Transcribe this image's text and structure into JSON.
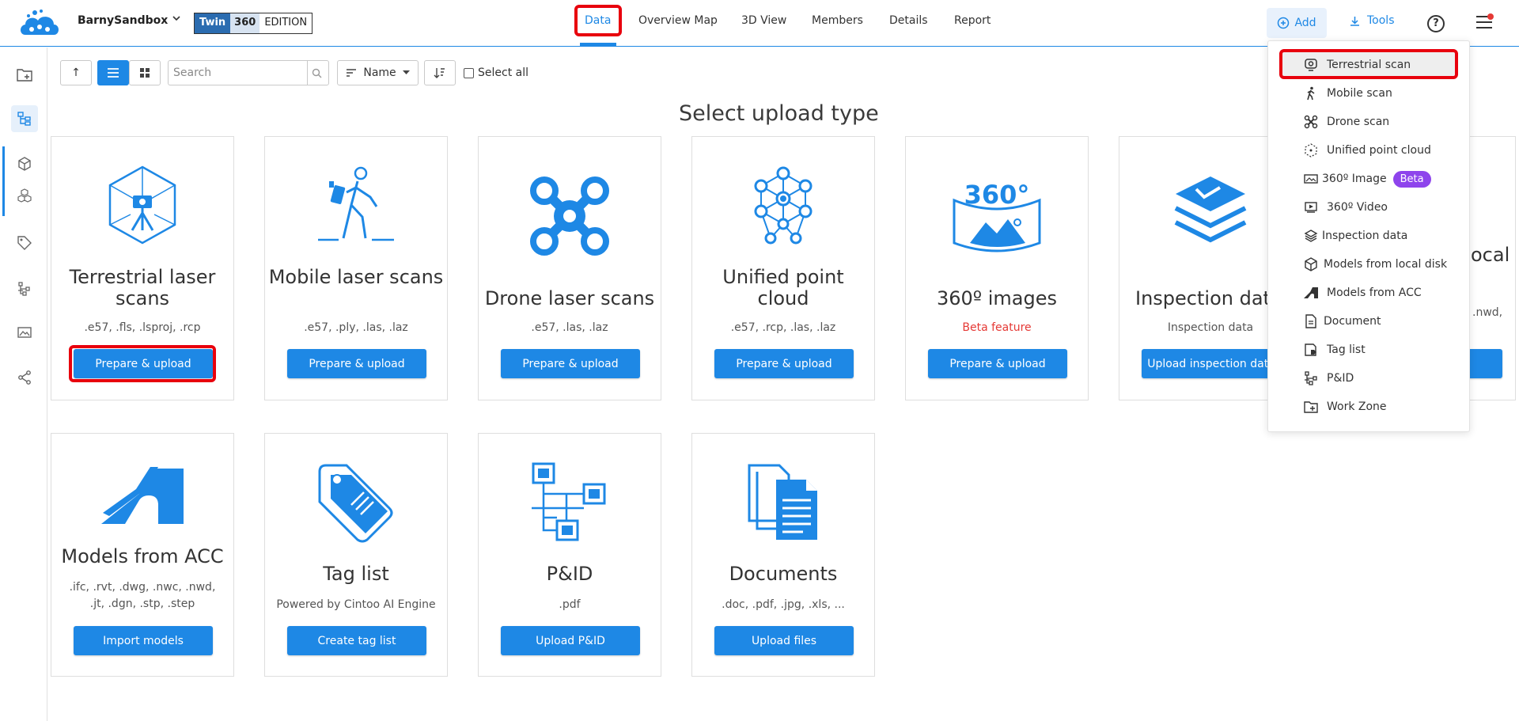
{
  "app": {
    "project_name": "BarnySandbox",
    "edition": {
      "part1": "Twin",
      "part2": "360",
      "part3": "EDITION"
    }
  },
  "nav": {
    "tabs": [
      "Data",
      "Overview Map",
      "3D View",
      "Members",
      "Details",
      "Report"
    ],
    "active": "Data"
  },
  "header_actions": {
    "add_label": "Add",
    "tools_label": "Tools",
    "help_label": "?"
  },
  "toolbar": {
    "search_placeholder": "Search",
    "sort_label": "Name",
    "select_all_label": "Select all",
    "up_label": "↑"
  },
  "page_title": "Select upload type",
  "cards": [
    {
      "title": "Terrestrial laser scans",
      "subtitle": ".e57, .fls, .lsproj, .rcp",
      "button": "Prepare & upload",
      "icon": "terrestrial-scanner-icon"
    },
    {
      "title": "Mobile laser scans",
      "subtitle": ".e57, .ply, .las, .laz",
      "button": "Prepare & upload",
      "icon": "walking-scanner-icon"
    },
    {
      "title": "Drone laser scans",
      "subtitle": ".e57, .las, .laz",
      "button": "Prepare & upload",
      "icon": "drone-icon"
    },
    {
      "title": "Unified point cloud",
      "subtitle": ".e57, .rcp, .las, .laz",
      "button": "Prepare & upload",
      "icon": "point-cloud-icon"
    },
    {
      "title": "360º images",
      "subtitle": "Beta feature",
      "button": "Prepare & upload",
      "icon": "360-image-icon"
    },
    {
      "title": "Inspection dat",
      "subtitle": "Inspection data",
      "button": "Upload inspection data",
      "icon": "inspection-layers-icon"
    },
    {
      "title": "ocal",
      "subtitle": ".nwd,",
      "button": "",
      "icon": ""
    },
    {
      "title": "Models from ACC",
      "subtitle": ".ifc, .rvt, .dwg, .nwc, .nwd, .jt, .dgn, .stp, .step",
      "button": "Import models",
      "icon": "acc-logo-icon"
    },
    {
      "title": "Tag list",
      "subtitle": "Powered by Cintoo AI Engine",
      "button": "Create tag list",
      "icon": "tag-icon"
    },
    {
      "title": "P&ID",
      "subtitle": ".pdf",
      "button": "Upload P&ID",
      "icon": "pid-diagram-icon"
    },
    {
      "title": "Documents",
      "subtitle": ".doc, .pdf, .jpg, .xls, ...",
      "button": "Upload files",
      "icon": "documents-icon"
    }
  ],
  "dropdown": {
    "items": [
      {
        "label": "Terrestrial scan",
        "icon": "scanner-icon"
      },
      {
        "label": "Mobile scan",
        "icon": "walking-person-icon"
      },
      {
        "label": "Drone scan",
        "icon": "drone-icon"
      },
      {
        "label": "Unified point cloud",
        "icon": "point-cloud-icon"
      },
      {
        "label": "360º Image",
        "icon": "panorama-icon",
        "badge": "Beta"
      },
      {
        "label": "360º Video",
        "icon": "video-icon"
      },
      {
        "label": "Inspection data",
        "icon": "layers-icon"
      },
      {
        "label": "Models from local disk",
        "icon": "cube-icon"
      },
      {
        "label": "Models from ACC",
        "icon": "acc-icon"
      },
      {
        "label": "Document",
        "icon": "document-icon"
      },
      {
        "label": "Tag list",
        "icon": "tag-list-icon"
      },
      {
        "label": "P&ID",
        "icon": "pid-icon"
      },
      {
        "label": "Work Zone",
        "icon": "work-zone-icon"
      }
    ]
  },
  "colors": {
    "accent": "#1e88e5",
    "highlight": "#e8000d",
    "beta": "#8e44ec",
    "beta_text": "#e53935"
  }
}
